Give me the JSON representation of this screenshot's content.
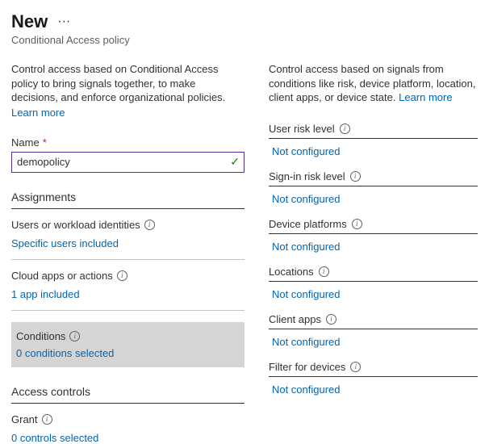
{
  "header": {
    "title": "New",
    "subtitle": "Conditional Access policy"
  },
  "left": {
    "description": "Control access based on Conditional Access policy to bring signals together, to make decisions, and enforce organizational policies.",
    "learn_more": "Learn more",
    "name_label": "Name",
    "name_value": "demopolicy",
    "assignments_title": "Assignments",
    "users_label": "Users or workload identities",
    "users_value": "Specific users included",
    "cloud_label": "Cloud apps or actions",
    "cloud_value": "1 app included",
    "conditions_label": "Conditions",
    "conditions_value": "0 conditions selected",
    "access_title": "Access controls",
    "grant_label": "Grant",
    "grant_value": "0 controls selected"
  },
  "right": {
    "description": "Control access based on signals from conditions like risk, device platform, location, client apps, or device state.",
    "learn_more": "Learn more",
    "items": [
      {
        "label": "User risk level",
        "value": "Not configured"
      },
      {
        "label": "Sign-in risk level",
        "value": "Not configured"
      },
      {
        "label": "Device platforms",
        "value": "Not configured"
      },
      {
        "label": "Locations",
        "value": "Not configured"
      },
      {
        "label": "Client apps",
        "value": "Not configured"
      },
      {
        "label": "Filter for devices",
        "value": "Not configured"
      }
    ]
  }
}
